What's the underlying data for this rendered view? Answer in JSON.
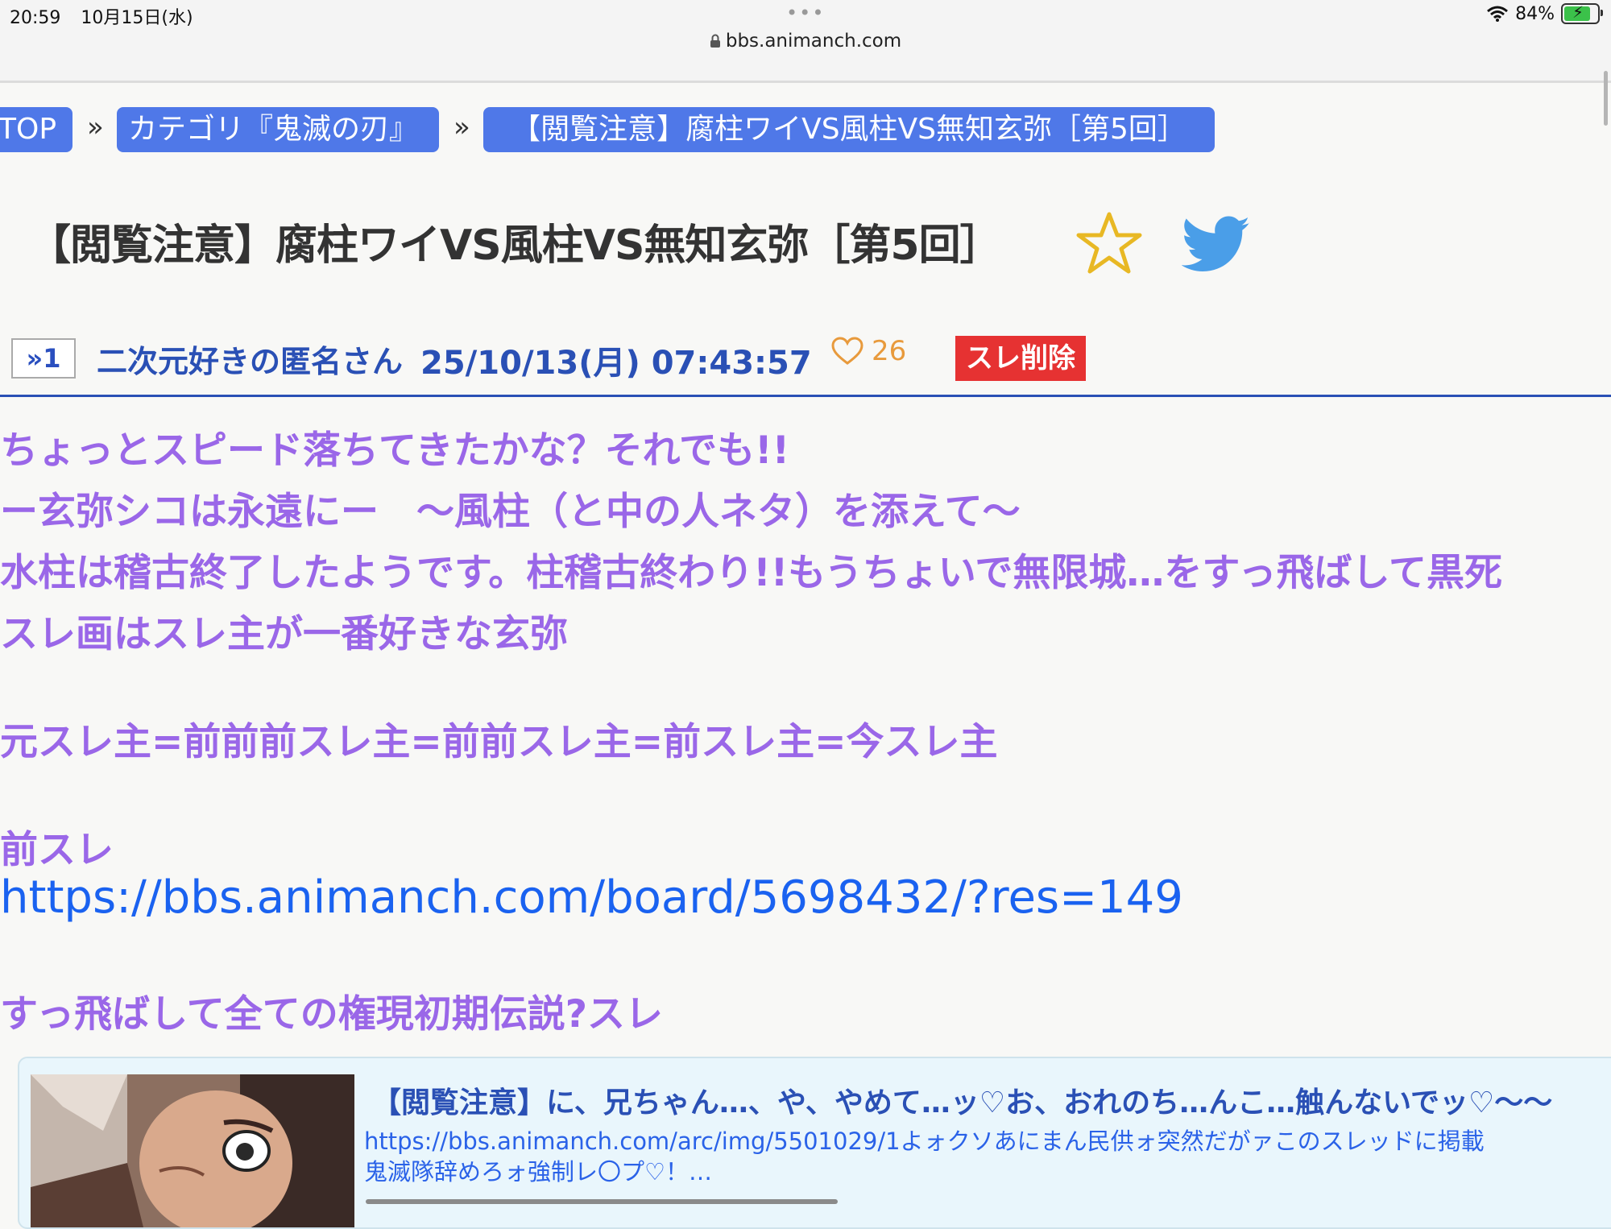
{
  "status_bar": {
    "time": "20:59",
    "date": "10月15日(水)",
    "dots": "•••",
    "url": "bbs.animanch.com",
    "battery_percent": "84%",
    "battery_level": 0.84
  },
  "breadcrumb": {
    "top": "TOP",
    "sep1": "»",
    "category": "カテゴリ『鬼滅の刃』",
    "sep2": "»",
    "thread": "【閲覧注意】腐柱ワイVS風柱VS無知玄弥［第5回］"
  },
  "thread": {
    "title": "【閲覧注意】腐柱ワイVS風柱VS無知玄弥［第5回］"
  },
  "post": {
    "number": "»1",
    "author": "二次元好きの匿名さん",
    "date": "25/10/13(月) 07:43:57",
    "likes": "26",
    "delete_label": "スレ削除",
    "lines": [
      "ちょっとスピード落ちてきたかな？それでも!!",
      "ー玄弥シコは永遠にー　～風柱（と中の人ネタ）を添えて～",
      "水柱は稽古終了したようです。柱稽古終わり!!もうちょいで無限城…をすっ飛ばして黒死",
      "スレ画はスレ主が一番好きな玄弥",
      "元スレ主=前前前スレ主=前前スレ主=前スレ主=今スレ主",
      "前スレ"
    ],
    "link": "https://bbs.animanch.com/board/5698432/?res=149",
    "tail": "すっ飛ばして全ての権現初期伝説?スレ"
  },
  "link_card": {
    "title": "【閲覧注意】に、兄ちゃん…、や、やめて…ッ♡お、おれのち…んこ…触んないでッ♡〜〜",
    "desc_line1": "https://bbs.animanch.com/arc/img/5501029/1よォクソあにまん民供ォ突然だがァこのスレッドに掲載",
    "desc_line2": "鬼滅隊辞めろォ強制レ〇プ♡！…"
  },
  "colors": {
    "breadcrumb_bg": "#4f78e8",
    "body_text": "#9a67e8",
    "link": "#1a62f0",
    "author": "#2a50b5",
    "delete": "#e63232",
    "like": "#e89a3c",
    "star": "#e8b824",
    "twitter": "#4a9ee8"
  },
  "icons": [
    "lock-icon",
    "wifi-icon",
    "battery-icon",
    "star-icon",
    "twitter-icon",
    "heart-icon"
  ]
}
